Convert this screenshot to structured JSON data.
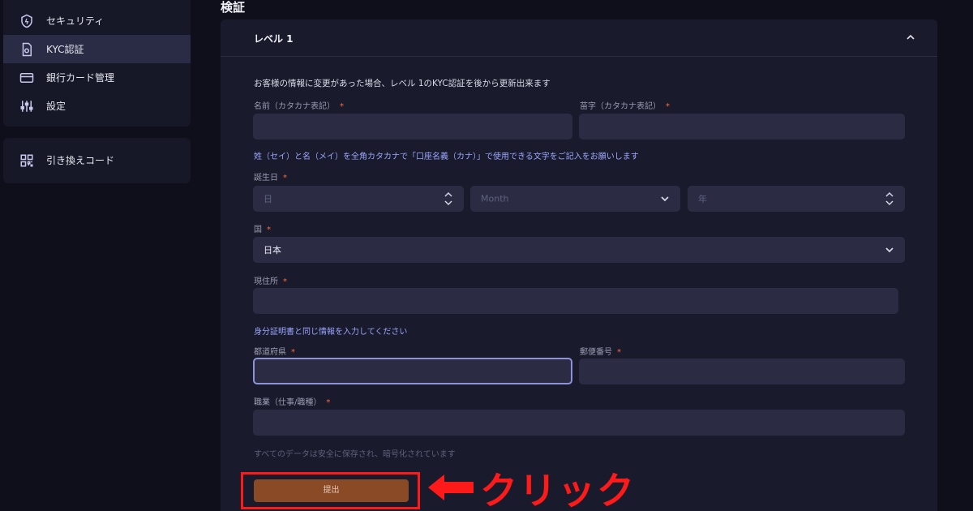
{
  "sidebar": {
    "items": [
      {
        "label": "セキュリティ",
        "icon": "shield-icon"
      },
      {
        "label": "KYC認証",
        "icon": "id-document-icon",
        "active": true
      },
      {
        "label": "銀行カード管理",
        "icon": "credit-card-icon"
      },
      {
        "label": "設定",
        "icon": "sliders-icon"
      }
    ],
    "secondary": [
      {
        "label": "引き換えコード",
        "icon": "qr-code-icon"
      }
    ]
  },
  "page": {
    "title": "検証"
  },
  "card": {
    "title": "レベル 1",
    "intro": "お客様の情報に変更があった場合、レベル 1のKYC認証を後から更新出来ます"
  },
  "form": {
    "first_name_label": "名前（カタカナ表記）",
    "last_name_label": "苗字（カタカナ表記）",
    "name_note": "姓（セイ）と名（メイ）を全角カタカナで「口座名義（カナ）」で使用できる文字をご記入をお願いします",
    "birthday_label": "誕生日",
    "day_placeholder": "日",
    "month_placeholder": "Month",
    "year_placeholder": "年",
    "country_label": "国",
    "country_value": "日本",
    "address_label": "現住所",
    "id_note": "身分証明書と同じ情報を入力してください",
    "prefecture_label": "都道府県",
    "postal_label": "郵便番号",
    "occupation_label": "職業（仕事/職種）",
    "security_note": "すべてのデータは安全に保存され、暗号化されています",
    "required_mark": "*",
    "submit_label": "提出"
  },
  "annotation": {
    "text": "クリック",
    "color": "#ff1a1a"
  },
  "colors": {
    "accent": "#9aa7ff",
    "submit": "#8a4a26",
    "required": "#ff6a3d"
  }
}
